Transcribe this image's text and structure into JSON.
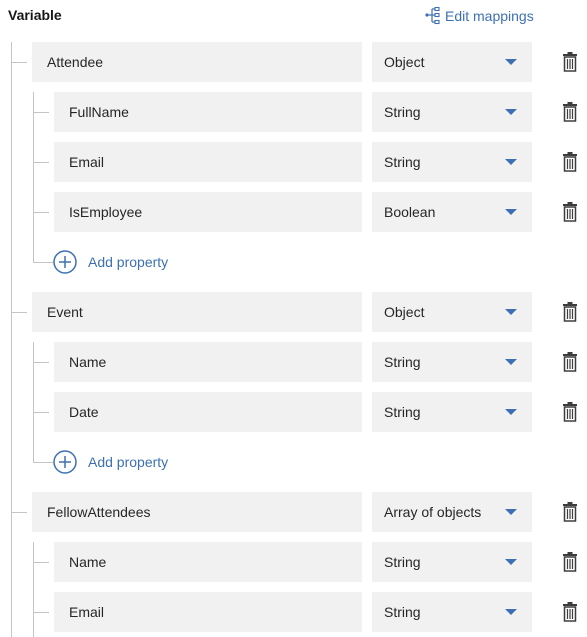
{
  "header": {
    "title": "Variable",
    "edit_mappings_label": "Edit mappings",
    "edit_mappings_icon": "mapping-tree-icon"
  },
  "colors": {
    "accent": "#3d70b2",
    "field_background": "#f1f1f1",
    "tree_line": "#c4c4c4",
    "trash_icon": "#3d3d3d"
  },
  "variables": [
    {
      "name": "Attendee",
      "type": "Object",
      "properties": [
        {
          "name": "FullName",
          "type": "String"
        },
        {
          "name": "Email",
          "type": "String"
        },
        {
          "name": "IsEmployee",
          "type": "Boolean"
        }
      ],
      "add_property_label": "Add property"
    },
    {
      "name": "Event",
      "type": "Object",
      "properties": [
        {
          "name": "Name",
          "type": "String"
        },
        {
          "name": "Date",
          "type": "String"
        }
      ],
      "add_property_label": "Add property"
    },
    {
      "name": "FellowAttendees",
      "type": "Array of objects",
      "properties": [
        {
          "name": "Name",
          "type": "String"
        },
        {
          "name": "Email",
          "type": "String"
        }
      ]
    }
  ],
  "icons": {
    "delete": "trash-icon",
    "dropdown": "caret-down-icon",
    "add": "add-circle-icon"
  }
}
